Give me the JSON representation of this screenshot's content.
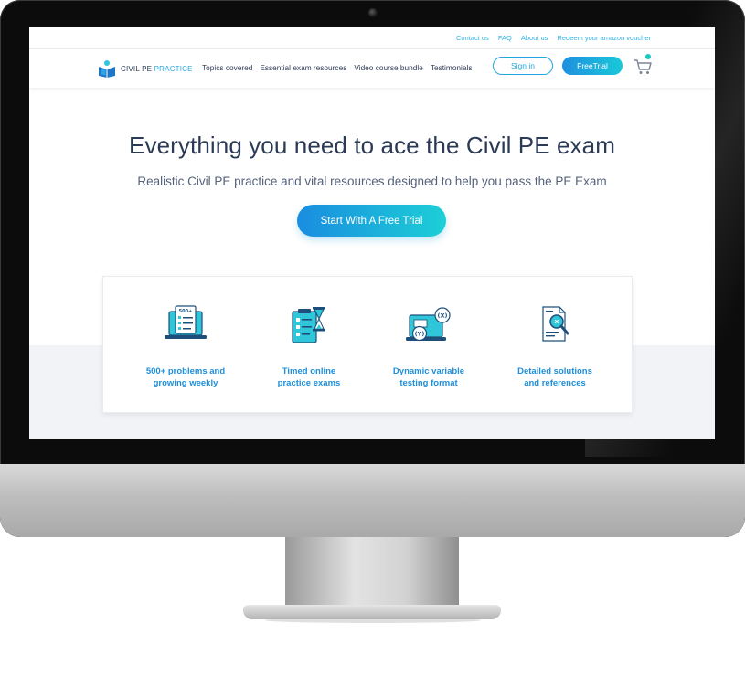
{
  "utility_links": [
    "Contact us",
    "FAQ",
    "About us",
    "Redeem your amazon voucher"
  ],
  "logo": {
    "civil": "CIVIL PE ",
    "practice": "PRACTICE"
  },
  "nav": {
    "links": [
      "Topics covered",
      "Essential exam resources",
      "Video course bundle",
      "Testimonials"
    ]
  },
  "buttons": {
    "sign_in": "Sign in",
    "free_trial": "FreeTrial",
    "cta": "Start With A Free Trial"
  },
  "hero": {
    "title": "Everything you need to ace the Civil PE exam",
    "subtitle": "Realistic Civil PE practice and vital resources designed to help you pass the PE Exam"
  },
  "features": [
    {
      "icon": "laptop-checklist-icon",
      "line1": "500+ problems and",
      "line2": "growing weekly",
      "badge": "500+"
    },
    {
      "icon": "timer-clipboard-icon",
      "line1": "Timed online",
      "line2": "practice exams"
    },
    {
      "icon": "variable-laptop-icon",
      "line1": "Dynamic variable",
      "line2": "testing format",
      "var_x": "(X)",
      "var_y": "(Y)"
    },
    {
      "icon": "magnifier-document-icon",
      "line1": "Detailed solutions",
      "line2": "and references"
    }
  ],
  "colors": {
    "accent": "#22a6e0",
    "teal": "#19c9d8",
    "navy": "#2b3a55"
  }
}
